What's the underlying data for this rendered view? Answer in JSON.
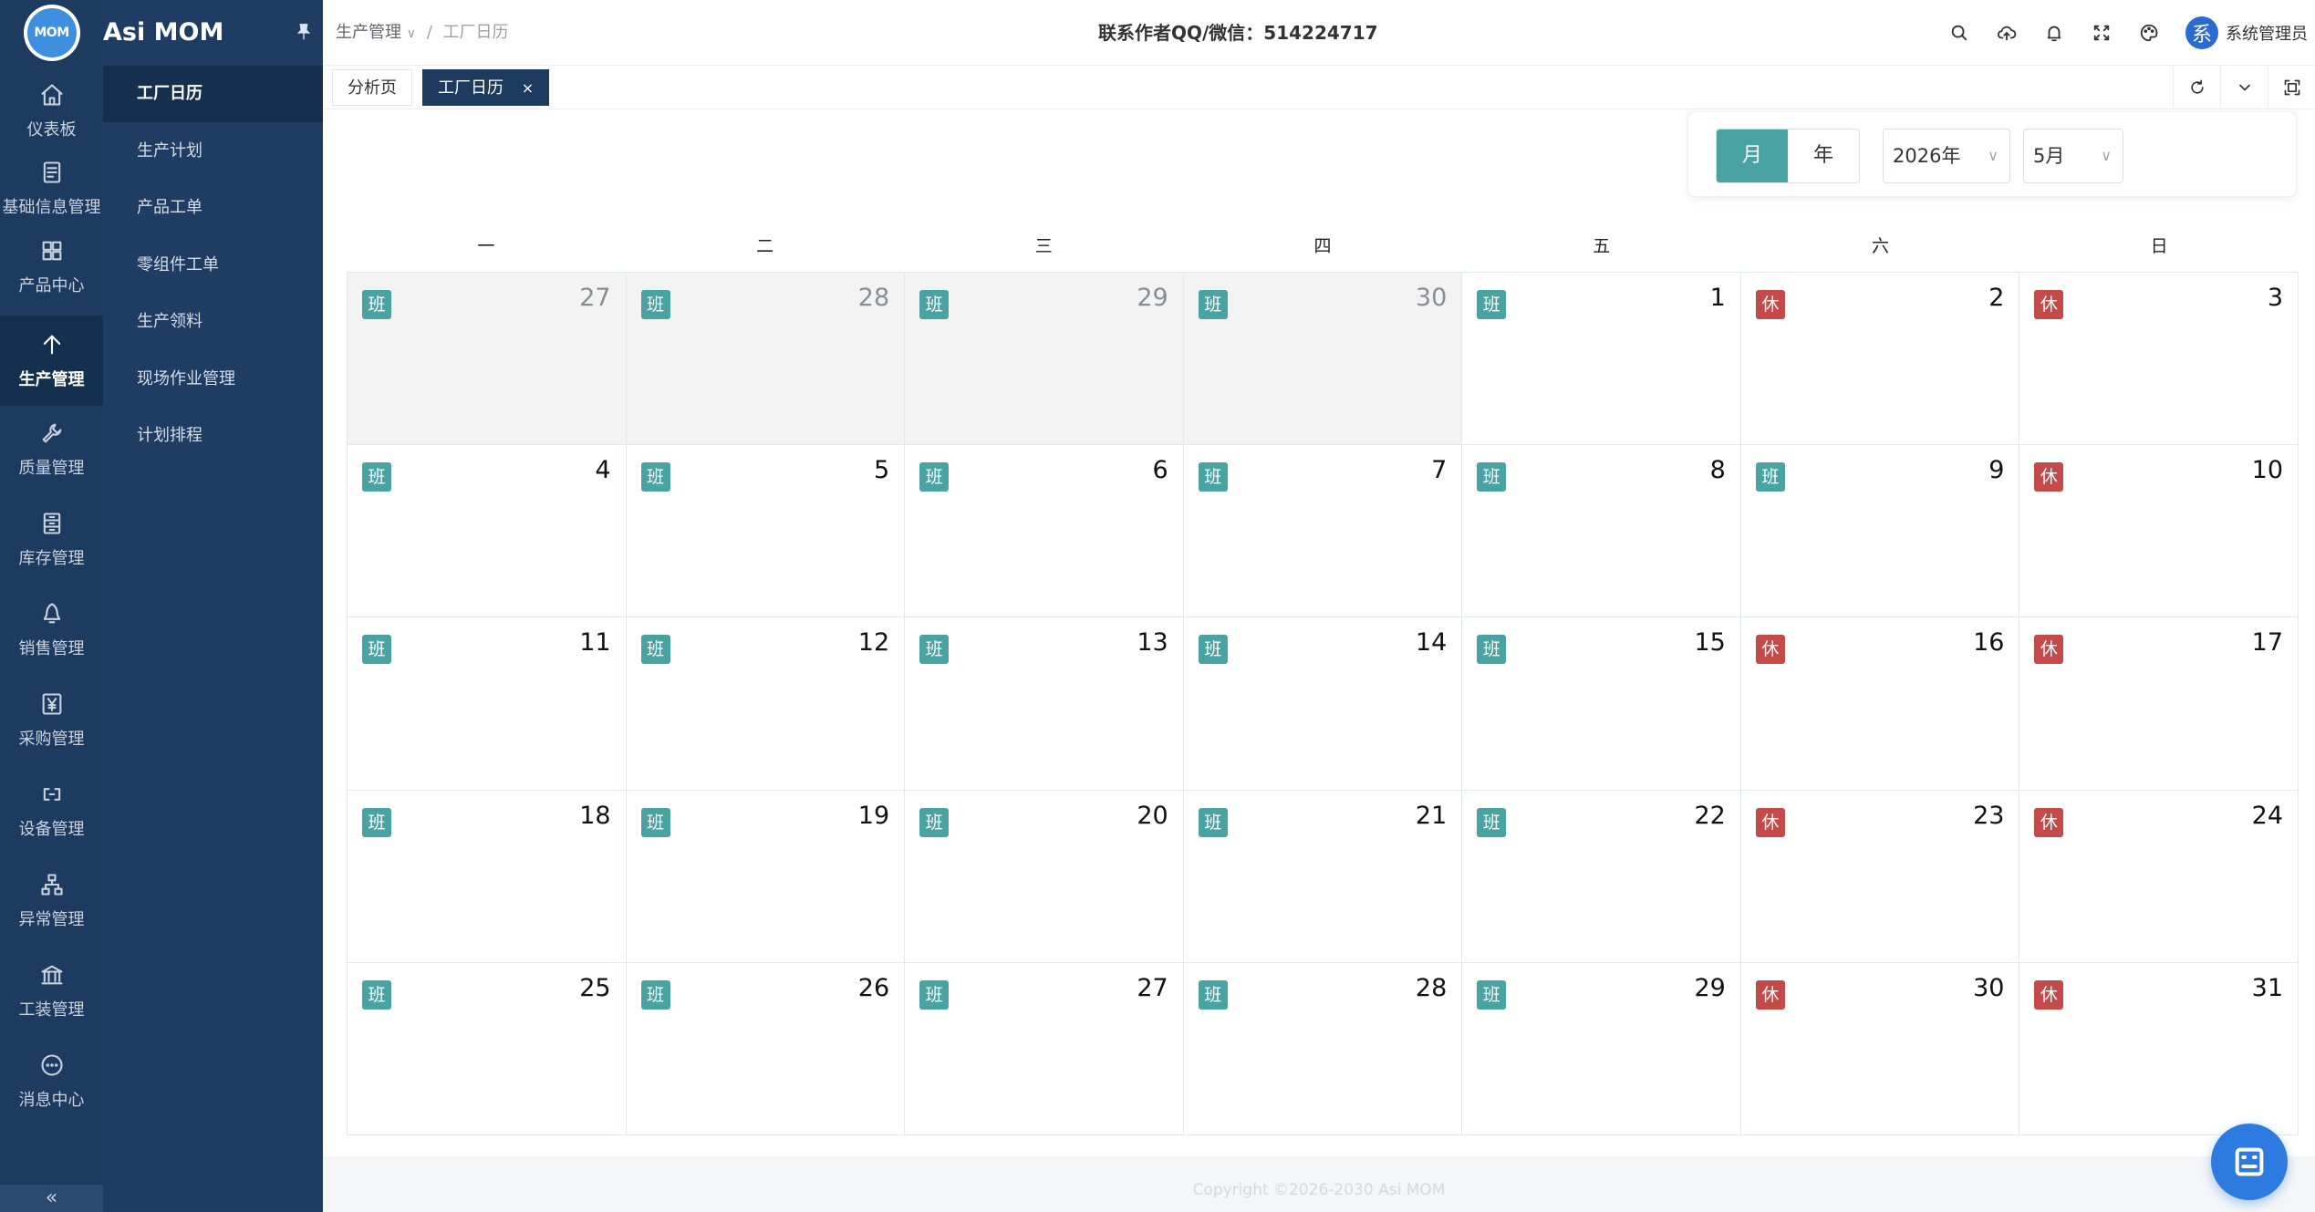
{
  "app": {
    "name": "Asi MOM",
    "logo_text": "MOM"
  },
  "rail": {
    "items": [
      {
        "label": "仪表板",
        "icon": "home-icon",
        "active": false
      },
      {
        "label": "基础信息管理",
        "icon": "document-icon",
        "active": false
      },
      {
        "label": "产品中心",
        "icon": "grid-icon",
        "active": false
      },
      {
        "label": "生产管理",
        "icon": "arrow-up-icon",
        "active": true
      },
      {
        "label": "质量管理",
        "icon": "wrench-icon",
        "active": false
      },
      {
        "label": "库存管理",
        "icon": "inventory-icon",
        "active": false
      },
      {
        "label": "销售管理",
        "icon": "bell-icon",
        "active": false
      },
      {
        "label": "采购管理",
        "icon": "yen-icon",
        "active": false
      },
      {
        "label": "设备管理",
        "icon": "device-icon",
        "active": false
      },
      {
        "label": "异常管理",
        "icon": "hierarchy-icon",
        "active": false
      },
      {
        "label": "工装管理",
        "icon": "bank-icon",
        "active": false
      },
      {
        "label": "消息中心",
        "icon": "message-icon",
        "active": false
      }
    ],
    "collapse_label": "«"
  },
  "submenu": {
    "items": [
      {
        "label": "工厂日历",
        "active": true
      },
      {
        "label": "生产计划",
        "active": false
      },
      {
        "label": "产品工单",
        "active": false
      },
      {
        "label": "零组件工单",
        "active": false
      },
      {
        "label": "生产领料",
        "active": false
      },
      {
        "label": "现场作业管理",
        "active": false
      },
      {
        "label": "计划排程",
        "active": false
      }
    ]
  },
  "header": {
    "breadcrumb": {
      "parent": "生产管理",
      "sep": "/",
      "current": "工厂日历"
    },
    "contact": "联系作者QQ/微信：514224717",
    "user": {
      "avatar": "系",
      "name": "系统管理员"
    }
  },
  "tabs": [
    {
      "label": "分析页",
      "active": false
    },
    {
      "label": "工厂日历",
      "active": true,
      "close": "×"
    }
  ],
  "calendar": {
    "view_month": "月",
    "view_year": "年",
    "year_select": "2026年",
    "month_select": "5月",
    "weekdays": [
      "一",
      "二",
      "三",
      "四",
      "五",
      "六",
      "日"
    ],
    "work_label": "班",
    "rest_label": "休",
    "colors": {
      "work": "#4aa3a3",
      "rest": "#c44a4a"
    },
    "days": [
      {
        "day": "27",
        "type": "work",
        "other_month": true
      },
      {
        "day": "28",
        "type": "work",
        "other_month": true
      },
      {
        "day": "29",
        "type": "work",
        "other_month": true
      },
      {
        "day": "30",
        "type": "work",
        "other_month": true
      },
      {
        "day": "1",
        "type": "work",
        "other_month": false
      },
      {
        "day": "2",
        "type": "rest",
        "other_month": false
      },
      {
        "day": "3",
        "type": "rest",
        "other_month": false
      },
      {
        "day": "4",
        "type": "work",
        "other_month": false
      },
      {
        "day": "5",
        "type": "work",
        "other_month": false
      },
      {
        "day": "6",
        "type": "work",
        "other_month": false
      },
      {
        "day": "7",
        "type": "work",
        "other_month": false
      },
      {
        "day": "8",
        "type": "work",
        "other_month": false
      },
      {
        "day": "9",
        "type": "work",
        "other_month": false
      },
      {
        "day": "10",
        "type": "rest",
        "other_month": false
      },
      {
        "day": "11",
        "type": "work",
        "other_month": false
      },
      {
        "day": "12",
        "type": "work",
        "other_month": false
      },
      {
        "day": "13",
        "type": "work",
        "other_month": false
      },
      {
        "day": "14",
        "type": "work",
        "other_month": false
      },
      {
        "day": "15",
        "type": "work",
        "other_month": false
      },
      {
        "day": "16",
        "type": "rest",
        "other_month": false
      },
      {
        "day": "17",
        "type": "rest",
        "other_month": false
      },
      {
        "day": "18",
        "type": "work",
        "other_month": false
      },
      {
        "day": "19",
        "type": "work",
        "other_month": false
      },
      {
        "day": "20",
        "type": "work",
        "other_month": false
      },
      {
        "day": "21",
        "type": "work",
        "other_month": false
      },
      {
        "day": "22",
        "type": "work",
        "other_month": false
      },
      {
        "day": "23",
        "type": "rest",
        "other_month": false
      },
      {
        "day": "24",
        "type": "rest",
        "other_month": false
      },
      {
        "day": "25",
        "type": "work",
        "other_month": false
      },
      {
        "day": "26",
        "type": "work",
        "other_month": false
      },
      {
        "day": "27",
        "type": "work",
        "other_month": false
      },
      {
        "day": "28",
        "type": "work",
        "other_month": false
      },
      {
        "day": "29",
        "type": "work",
        "other_month": false
      },
      {
        "day": "30",
        "type": "rest",
        "other_month": false
      },
      {
        "day": "31",
        "type": "rest",
        "other_month": false
      }
    ]
  },
  "footer": {
    "copyright": "Copyright ©2026-2030 Asi MOM"
  }
}
